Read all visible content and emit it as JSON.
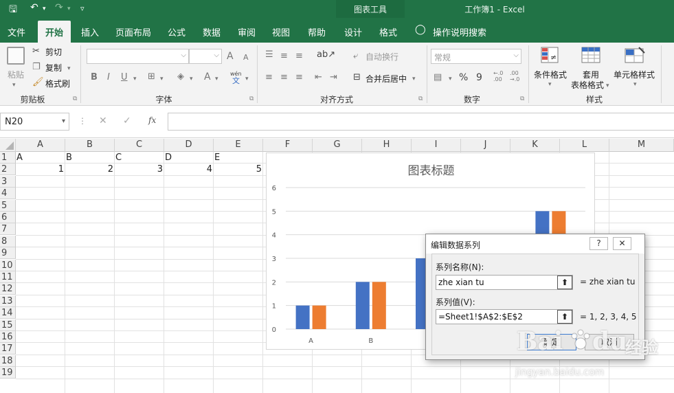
{
  "titlebar": {
    "chart_tools": "图表工具",
    "doc_title": "工作簿1  -  Excel"
  },
  "tabs": [
    {
      "label": "文件"
    },
    {
      "label": "开始"
    },
    {
      "label": "插入"
    },
    {
      "label": "页面布局"
    },
    {
      "label": "公式"
    },
    {
      "label": "数据"
    },
    {
      "label": "审阅"
    },
    {
      "label": "视图"
    },
    {
      "label": "帮助"
    },
    {
      "label": "设计"
    },
    {
      "label": "格式"
    },
    {
      "label": "操作说明搜索"
    }
  ],
  "ribbon": {
    "clipboard": {
      "paste": "粘贴",
      "cut": "剪切",
      "copy": "复制",
      "format_painter": "格式刷",
      "group": "剪贴板"
    },
    "font": {
      "group": "字体",
      "bold": "B",
      "italic": "I",
      "underline": "U",
      "phonetic_top": "wén",
      "phonetic_bottom": "文",
      "grow": "A",
      "shrink": "A",
      "font_color": "A"
    },
    "alignment": {
      "wrap_text": "自动换行",
      "merge_center": "合并后居中",
      "group": "对齐方式"
    },
    "number": {
      "format": "常规",
      "percent": "%",
      "comma": "9",
      "inc_decimal": "←.0 .00",
      "dec_decimal": ".00 →.0",
      "group": "数字"
    },
    "styles": {
      "conditional": "条件格式",
      "table_line1": "套用",
      "table_line2": "表格格式",
      "cell_styles": "单元格样式",
      "group": "样式"
    }
  },
  "formula_bar": {
    "name_box": "N20",
    "fx": "fx",
    "cancel": "✕",
    "enter": "✓",
    "more": "⋮"
  },
  "columns": [
    "A",
    "B",
    "C",
    "D",
    "E",
    "F",
    "G",
    "H",
    "I",
    "J",
    "K",
    "L",
    "M"
  ],
  "rows": [
    "1",
    "2",
    "3",
    "4",
    "5",
    "6",
    "7",
    "8",
    "9",
    "10",
    "11",
    "12",
    "13",
    "14",
    "15",
    "16",
    "17",
    "18",
    "19"
  ],
  "cells": {
    "row1": [
      "A",
      "B",
      "C",
      "D",
      "E"
    ],
    "row2": [
      "1",
      "2",
      "3",
      "4",
      "5"
    ]
  },
  "chart": {
    "title": "图表标题"
  },
  "chart_data": {
    "type": "bar",
    "title": "图表标题",
    "categories": [
      "A",
      "B",
      "C",
      "D",
      "E"
    ],
    "series": [
      {
        "values": [
          1,
          2,
          3,
          4,
          5
        ],
        "color": "#4472c4"
      },
      {
        "values": [
          1,
          2,
          3,
          4,
          5
        ],
        "color": "#ed7d31"
      }
    ],
    "ylim": [
      0,
      6
    ],
    "yticks": [
      "0",
      "1",
      "2",
      "3",
      "4",
      "5",
      "6"
    ],
    "grid": true,
    "legend": "none"
  },
  "dialog": {
    "title": "编辑数据系列",
    "help": "?",
    "close": "✕",
    "name_label": "系列名称(N):",
    "name_value": "zhe xian tu",
    "name_result": "= zhe xian tu",
    "values_label": "系列值(V):",
    "values_value": "=Sheet1!$A$2:$E$2",
    "values_result": "= 1, 2, 3, 4, 5",
    "ok": "确定",
    "cancel": "取消",
    "collapse": "⬆"
  },
  "watermark": {
    "brand": "Bai",
    "paw": "du",
    "jingyan": "经验",
    "url": "jingyan.baidu.com"
  },
  "colors": {
    "excel_green": "#217346",
    "series1": "#4472c4",
    "series2": "#ed7d31"
  }
}
